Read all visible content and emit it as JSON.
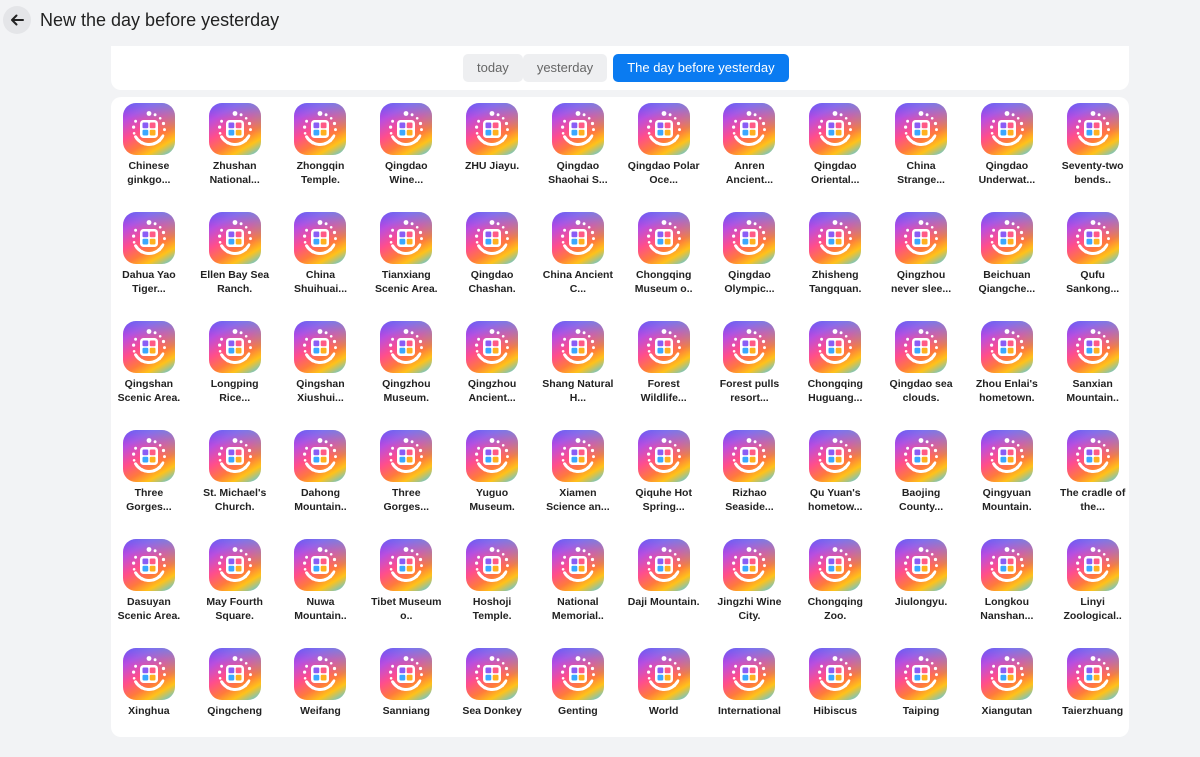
{
  "header": {
    "title": "New the day before yesterday"
  },
  "tabs": [
    {
      "label": "today",
      "active": false
    },
    {
      "label": "yesterday",
      "active": false
    },
    {
      "label": "The day before yesterday",
      "active": true
    }
  ],
  "colors": {
    "accent": "#0a7bf1",
    "background": "#f2f3f5"
  },
  "apps": [
    "Chinese ginkgo...",
    "Zhushan National...",
    "Zhongqin Temple.",
    "Qingdao Wine...",
    "ZHU Jiayu.",
    "Qingdao Shaohai S...",
    "Qingdao Polar Oce...",
    "Anren Ancient...",
    "Qingdao Oriental...",
    "China Strange...",
    "Qingdao Underwat...",
    "Seventy-two bends..",
    "Dahua Yao Tiger...",
    "Ellen Bay Sea Ranch.",
    "China Shuihuai...",
    "Tianxiang Scenic Area.",
    "Qingdao Chashan.",
    "China Ancient C...",
    "Chongqing Museum o..",
    "Qingdao Olympic...",
    "Zhisheng Tangquan.",
    "Qingzhou never slee...",
    "Beichuan Qiangche...",
    "Qufu Sankong...",
    "Qingshan Scenic Area.",
    "Longping Rice...",
    "Qingshan Xiushui...",
    "Qingzhou Museum.",
    "Qingzhou Ancient...",
    "Shang Natural H...",
    "Forest Wildlife...",
    "Forest pulls resort...",
    "Chongqing Huguang...",
    "Qingdao sea clouds.",
    "Zhou Enlai's hometown.",
    "Sanxian Mountain..",
    "Three Gorges...",
    "St. Michael's Church.",
    "Dahong Mountain..",
    "Three Gorges...",
    "Yuguo Museum.",
    "Xiamen Science an...",
    "Qiquhe Hot Spring...",
    "Rizhao Seaside...",
    "Qu Yuan's hometow...",
    "Baojing County...",
    "Qingyuan Mountain.",
    "The cradle of the...",
    "Dasuyan Scenic Area.",
    "May Fourth Square.",
    "Nuwa Mountain..",
    "Tibet Museum o..",
    "Hoshoji Temple.",
    "National Memorial..",
    "Daji Mountain.",
    "Jingzhi Wine City.",
    "Chongqing Zoo.",
    "Jiulongyu.",
    "Longkou Nanshan...",
    "Linyi Zoological..",
    "Xinghua",
    "Qingcheng",
    "Weifang",
    "Sanniang",
    "Sea Donkey",
    "Genting",
    "World",
    "International",
    "Hibiscus",
    "Taiping",
    "Xiangutan",
    "Taierzhuang"
  ],
  "app_icon_name": "app-grid-icon"
}
